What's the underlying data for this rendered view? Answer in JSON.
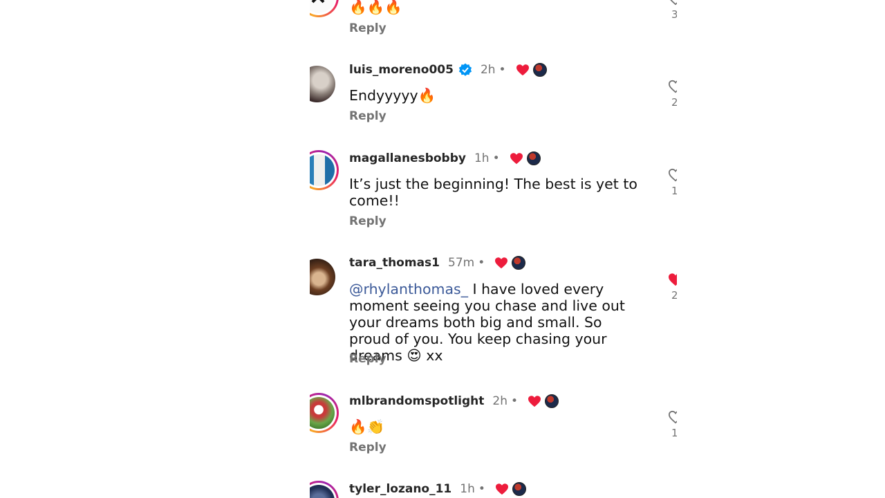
{
  "comments": [
    {
      "username": "",
      "time": "",
      "text": "🔥🔥🔥",
      "reply_label": "Reply",
      "likes": "3",
      "liked": false
    },
    {
      "username": "luis_moreno005",
      "verified": true,
      "time": "2h",
      "text": "Endyyyyy🔥",
      "reply_label": "Reply",
      "likes": "2",
      "liked": false
    },
    {
      "username": "magallanesbobby",
      "time": "1h",
      "text": "It’s just the beginning! The best is yet to come!!",
      "reply_label": "Reply",
      "likes": "1",
      "liked": false
    },
    {
      "username": "tara_thomas1",
      "time": "57m",
      "mention": "@rhylanthomas_",
      "text": " I have loved every moment seeing you chase and live out your dreams both big and small.  So proud of you. You keep chasing your dreams 😍 xx",
      "reply_label": "Reply",
      "likes": "2",
      "liked": true
    },
    {
      "username": "mlbrandomspotlight",
      "time": "2h",
      "text": "🔥👏",
      "reply_label": "Reply",
      "likes": "1",
      "liked": false
    },
    {
      "username": "tyler_lozano_11",
      "time": "1h",
      "text": "",
      "reply_label": "",
      "likes": "",
      "liked": false
    }
  ],
  "colors": {
    "heart_red": "#ed1c3c",
    "verified_blue": "#0095f6",
    "muted_text": "#737373",
    "mention_blue": "#3b5998"
  }
}
